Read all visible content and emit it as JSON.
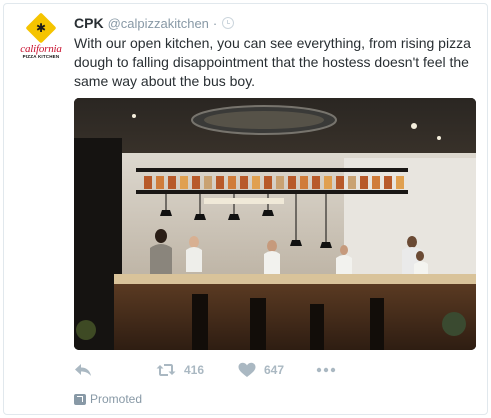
{
  "tweet": {
    "author_name": "CPK",
    "author_handle": "@calpizzakitchen",
    "separator": "·",
    "text": "With our open kitchen, you can see everything, from rising pizza dough to falling disappointment that the hostess doesn't feel the same way about the bus boy.",
    "avatar": {
      "word": "california",
      "subtext": "PIZZA KITCHEN",
      "icon": "palm-tree-icon",
      "color": "#f5c400"
    },
    "media": {
      "description_icon": "kitchen-photo"
    },
    "actions": {
      "reply_icon": "reply-icon",
      "retweet_icon": "retweet-icon",
      "retweet_count": "416",
      "like_icon": "heart-icon",
      "like_count": "647",
      "more_icon": "more-icon"
    },
    "promoted_label": "Promoted"
  },
  "colors": {
    "text": "#292f33",
    "muted": "#8899a6",
    "icon": "#aab8c2",
    "border": "#e1e8ed"
  }
}
